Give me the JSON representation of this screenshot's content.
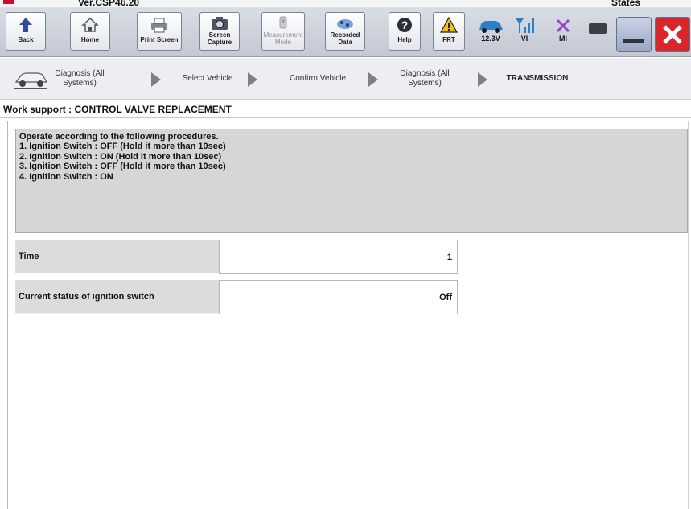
{
  "titlebar": {
    "version": "Ver.CSP46.20",
    "right_text": "States"
  },
  "toolbar": {
    "back": "Back",
    "home": "Home",
    "print_screen": "Print Screen",
    "screen_capture_1": "Screen",
    "screen_capture_2": "Capture",
    "measurement_1": "Measurement",
    "measurement_2": "Mode",
    "recorded_1": "Recorded",
    "recorded_2": "Data",
    "help": "Help",
    "frt": "FRT",
    "voltage": "12.3V",
    "vi": "VI",
    "mi": "MI"
  },
  "breadcrumb": {
    "item1_line1": "Diagnosis (All",
    "item1_line2": "Systems)",
    "item2": "Select Vehicle",
    "item3": "Confirm Vehicle",
    "item4_line1": "Diagnosis (All",
    "item4_line2": "Systems)",
    "item5": "TRANSMISSION"
  },
  "page": {
    "title": "Work support : CONTROL VALVE REPLACEMENT"
  },
  "instructions": [
    "Operate according to the following procedures.",
    "1. Ignition Switch : OFF (Hold it more than 10sec)",
    "2. Ignition Switch : ON  (Hold it more than 10sec)",
    "3. Ignition Switch : OFF (Hold it more than 10sec)",
    "4. Ignition Switch : ON"
  ],
  "rows": [
    {
      "label": "Time",
      "value": "1"
    },
    {
      "label": "Current status of ignition switch",
      "value": "Off"
    }
  ],
  "colors": {
    "close_red": "#d9262b",
    "arrow_gray": "#7d8088",
    "panel_gray": "#d6d6d6"
  }
}
